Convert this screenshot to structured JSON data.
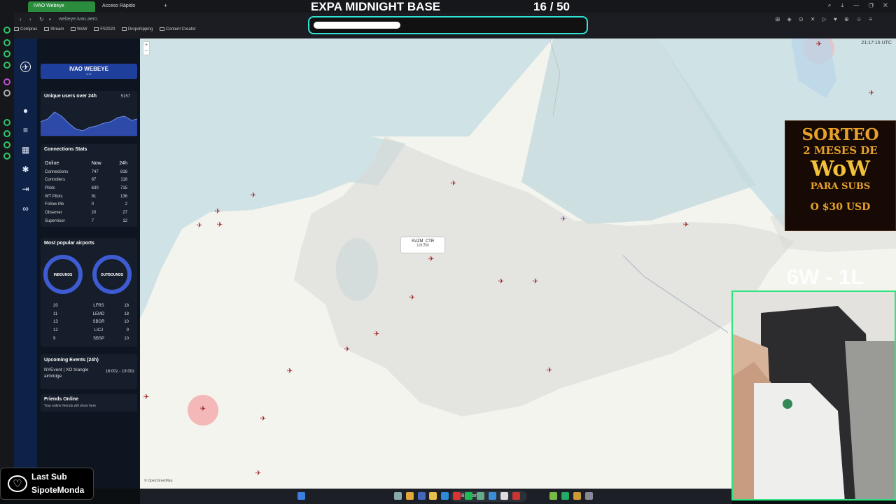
{
  "browser": {
    "tabs": [
      {
        "label": "IVAO Webeye"
      },
      {
        "label": "Acceso Rápido"
      }
    ],
    "url": "webeye.ivao.aero",
    "bookmarks": [
      "Compras",
      "Stream",
      "WoW",
      "FS2020",
      "Dropshipping",
      "Content Creator"
    ]
  },
  "stream": {
    "title": "EXPA MIDNIGHT BASE",
    "count": "16",
    "total": "/ 50",
    "progress": 0.32,
    "score": "6W - 1L",
    "last_sub_label": "Last Sub",
    "last_sub_name": "SipoteMonda",
    "promo": {
      "line1": "SORTEO",
      "line2": "2 MESES DE",
      "line3": "WoW",
      "line4": "PARA SUBS",
      "line5": "O $30 USD"
    }
  },
  "panel": {
    "logo_title": "IVAO WEBEYE",
    "logo_version": "4.17",
    "users_title": "Unique users over 24h",
    "users_value": "5157",
    "conn_title": "Connections Stats",
    "conn_head": [
      "",
      "Online",
      "Now",
      "24h"
    ],
    "conn_rows": [
      [
        "Connections",
        "747",
        "816"
      ],
      [
        "Controllers",
        "87",
        "118"
      ],
      [
        "Pilots",
        "630",
        "715"
      ],
      [
        "WT Pilots",
        "91",
        "136"
      ],
      [
        "Follow Me",
        "0",
        "2"
      ],
      [
        "Observer",
        "20",
        "27"
      ],
      [
        "Supervisor",
        "7",
        "12"
      ]
    ],
    "pop_title": "Most popular airports",
    "inbounds": "INBOUNDS",
    "outbounds": "OUTBOUNDS",
    "airports": [
      [
        "20",
        "LFRS",
        "18"
      ],
      [
        "11",
        "LEMD",
        "18"
      ],
      [
        "13",
        "SBGR",
        "10"
      ],
      [
        "12",
        "LICJ",
        "9"
      ],
      [
        "9",
        "SBSP",
        "10"
      ]
    ],
    "events_title": "Upcoming Events (24h)",
    "event_name": "NYEvent | XO triangle airbridge",
    "event_time": "16:00z - 19:00z",
    "friends_title": "Friends Online",
    "friends_sub": "Your online friends will show here"
  },
  "map": {
    "time": "21:17:15 UTC",
    "tooltip_code": "SVZM_CTR",
    "tooltip_freq": "128.200",
    "attribution": "© OpenStreetMap"
  },
  "taskbar": {
    "search": "Buscar"
  }
}
